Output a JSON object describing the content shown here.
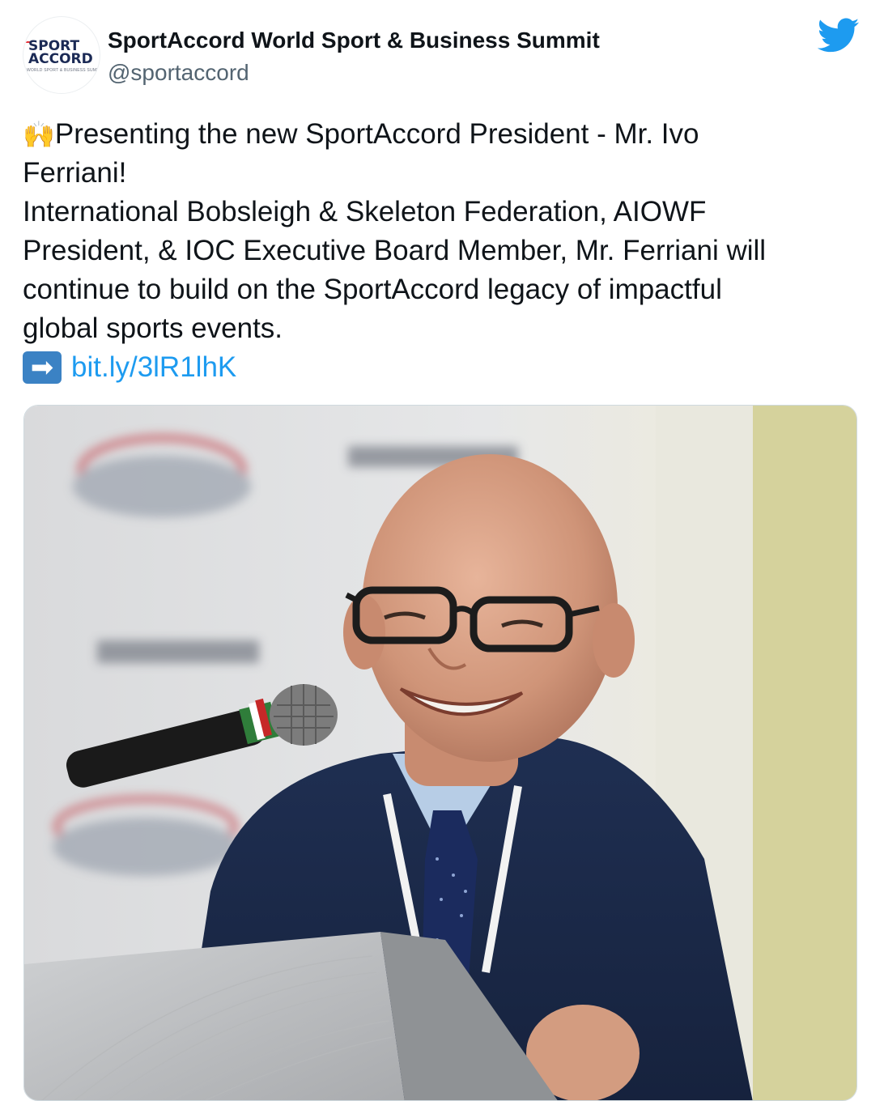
{
  "author": {
    "name": "SportAccord World Sport & Business Summit",
    "handle": "@sportaccord",
    "avatar_logo_line1": "SPORT",
    "avatar_logo_line2": "ACCORD",
    "avatar_logo_sub": "WORLD SPORT & BUSINESS SUMMIT",
    "avatar_icon": "sportaccord-logo"
  },
  "platform_icon": "twitter-bird-icon",
  "tweet": {
    "lead_emoji": "🙌",
    "line1": "Presenting the new SportAccord President - Mr. Ivo",
    "line2": "Ferriani!",
    "line3": "International Bobsleigh & Skeleton Federation, AIOWF",
    "line4": "President, & IOC Executive Board Member, Mr. Ferriani will",
    "line5": "continue to build on the SportAccord legacy of impactful",
    "line6": "global sports events.",
    "arrow_glyph": "➡",
    "link": "bit.ly/3lR1lhK"
  },
  "colors": {
    "accent": "#1d9bf0",
    "text": "#0f1419",
    "secondary": "#536471"
  },
  "media": {
    "photo_icon": "speaker-at-podium-photo"
  }
}
